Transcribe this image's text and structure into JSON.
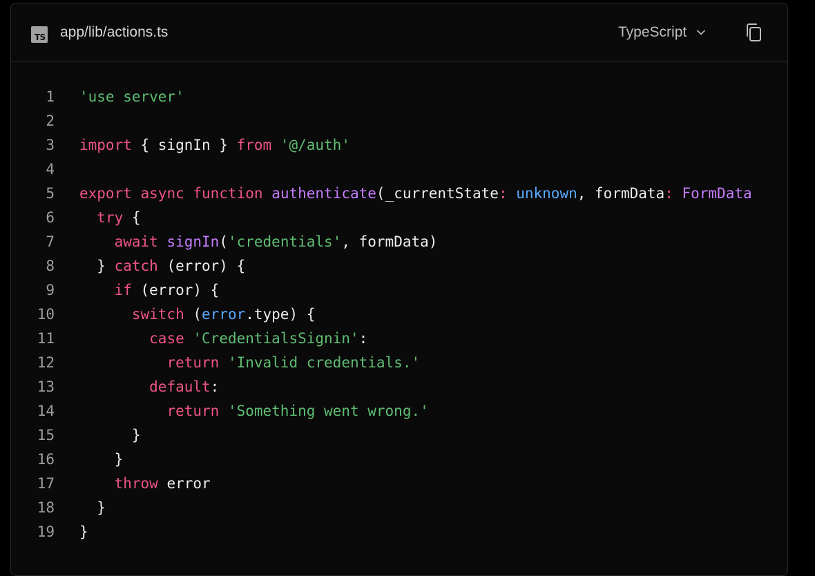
{
  "header": {
    "file_badge": "TS",
    "file_name": "app/lib/actions.ts",
    "language": "TypeScript"
  },
  "icons": {
    "file_type": "typescript-file-icon",
    "language_dropdown": "chevron-down-icon",
    "copy": "copy-icon"
  },
  "colors": {
    "background": "#0a0a0a",
    "border": "#2b2b2b",
    "string": "#5fbd73",
    "keyword": "#ee5584",
    "function": "#c77dff",
    "type": "#5aa9ff",
    "plain": "#ededed",
    "line_number": "#9e9e9e"
  },
  "code": {
    "lines": [
      {
        "num": "1",
        "tokens": [
          {
            "t": "'use server'",
            "k": "str"
          }
        ]
      },
      {
        "num": "2",
        "tokens": []
      },
      {
        "num": "3",
        "tokens": [
          {
            "t": "import",
            "k": "kw"
          },
          {
            "t": " { signIn } ",
            "k": "plain"
          },
          {
            "t": "from",
            "k": "kw"
          },
          {
            "t": " ",
            "k": "plain"
          },
          {
            "t": "'@/auth'",
            "k": "str"
          }
        ]
      },
      {
        "num": "4",
        "tokens": []
      },
      {
        "num": "5",
        "tokens": [
          {
            "t": "export",
            "k": "kw"
          },
          {
            "t": " ",
            "k": "plain"
          },
          {
            "t": "async",
            "k": "kw"
          },
          {
            "t": " ",
            "k": "plain"
          },
          {
            "t": "function",
            "k": "kw"
          },
          {
            "t": " ",
            "k": "plain"
          },
          {
            "t": "authenticate",
            "k": "fn"
          },
          {
            "t": "(_currentState",
            "k": "plain"
          },
          {
            "t": ": ",
            "k": "kw"
          },
          {
            "t": "unknown",
            "k": "type"
          },
          {
            "t": ", formData",
            "k": "plain"
          },
          {
            "t": ": ",
            "k": "kw"
          },
          {
            "t": "FormData",
            "k": "fn"
          }
        ]
      },
      {
        "num": "6",
        "tokens": [
          {
            "t": "  ",
            "k": "plain"
          },
          {
            "t": "try",
            "k": "kw"
          },
          {
            "t": " {",
            "k": "plain"
          }
        ]
      },
      {
        "num": "7",
        "tokens": [
          {
            "t": "    ",
            "k": "plain"
          },
          {
            "t": "await",
            "k": "kw"
          },
          {
            "t": " ",
            "k": "plain"
          },
          {
            "t": "signIn",
            "k": "fn"
          },
          {
            "t": "(",
            "k": "plain"
          },
          {
            "t": "'credentials'",
            "k": "str"
          },
          {
            "t": ", formData)",
            "k": "plain"
          }
        ]
      },
      {
        "num": "8",
        "tokens": [
          {
            "t": "  } ",
            "k": "plain"
          },
          {
            "t": "catch",
            "k": "kw"
          },
          {
            "t": " (error) {",
            "k": "plain"
          }
        ]
      },
      {
        "num": "9",
        "tokens": [
          {
            "t": "    ",
            "k": "plain"
          },
          {
            "t": "if",
            "k": "kw"
          },
          {
            "t": " (error) {",
            "k": "plain"
          }
        ]
      },
      {
        "num": "10",
        "tokens": [
          {
            "t": "      ",
            "k": "plain"
          },
          {
            "t": "switch",
            "k": "kw"
          },
          {
            "t": " (",
            "k": "plain"
          },
          {
            "t": "error",
            "k": "type"
          },
          {
            "t": ".type) {",
            "k": "plain"
          }
        ]
      },
      {
        "num": "11",
        "tokens": [
          {
            "t": "        ",
            "k": "plain"
          },
          {
            "t": "case",
            "k": "kw"
          },
          {
            "t": " ",
            "k": "plain"
          },
          {
            "t": "'CredentialsSignin'",
            "k": "str"
          },
          {
            "t": ":",
            "k": "plain"
          }
        ]
      },
      {
        "num": "12",
        "tokens": [
          {
            "t": "          ",
            "k": "plain"
          },
          {
            "t": "return",
            "k": "kw"
          },
          {
            "t": " ",
            "k": "plain"
          },
          {
            "t": "'Invalid credentials.'",
            "k": "str"
          }
        ]
      },
      {
        "num": "13",
        "tokens": [
          {
            "t": "        ",
            "k": "plain"
          },
          {
            "t": "default",
            "k": "kw"
          },
          {
            "t": ":",
            "k": "plain"
          }
        ]
      },
      {
        "num": "14",
        "tokens": [
          {
            "t": "          ",
            "k": "plain"
          },
          {
            "t": "return",
            "k": "kw"
          },
          {
            "t": " ",
            "k": "plain"
          },
          {
            "t": "'Something went wrong.'",
            "k": "str"
          }
        ]
      },
      {
        "num": "15",
        "tokens": [
          {
            "t": "      }",
            "k": "plain"
          }
        ]
      },
      {
        "num": "16",
        "tokens": [
          {
            "t": "    }",
            "k": "plain"
          }
        ]
      },
      {
        "num": "17",
        "tokens": [
          {
            "t": "    ",
            "k": "plain"
          },
          {
            "t": "throw",
            "k": "kw"
          },
          {
            "t": " error",
            "k": "plain"
          }
        ]
      },
      {
        "num": "18",
        "tokens": [
          {
            "t": "  }",
            "k": "plain"
          }
        ]
      },
      {
        "num": "19",
        "tokens": [
          {
            "t": "}",
            "k": "plain"
          }
        ]
      }
    ]
  }
}
